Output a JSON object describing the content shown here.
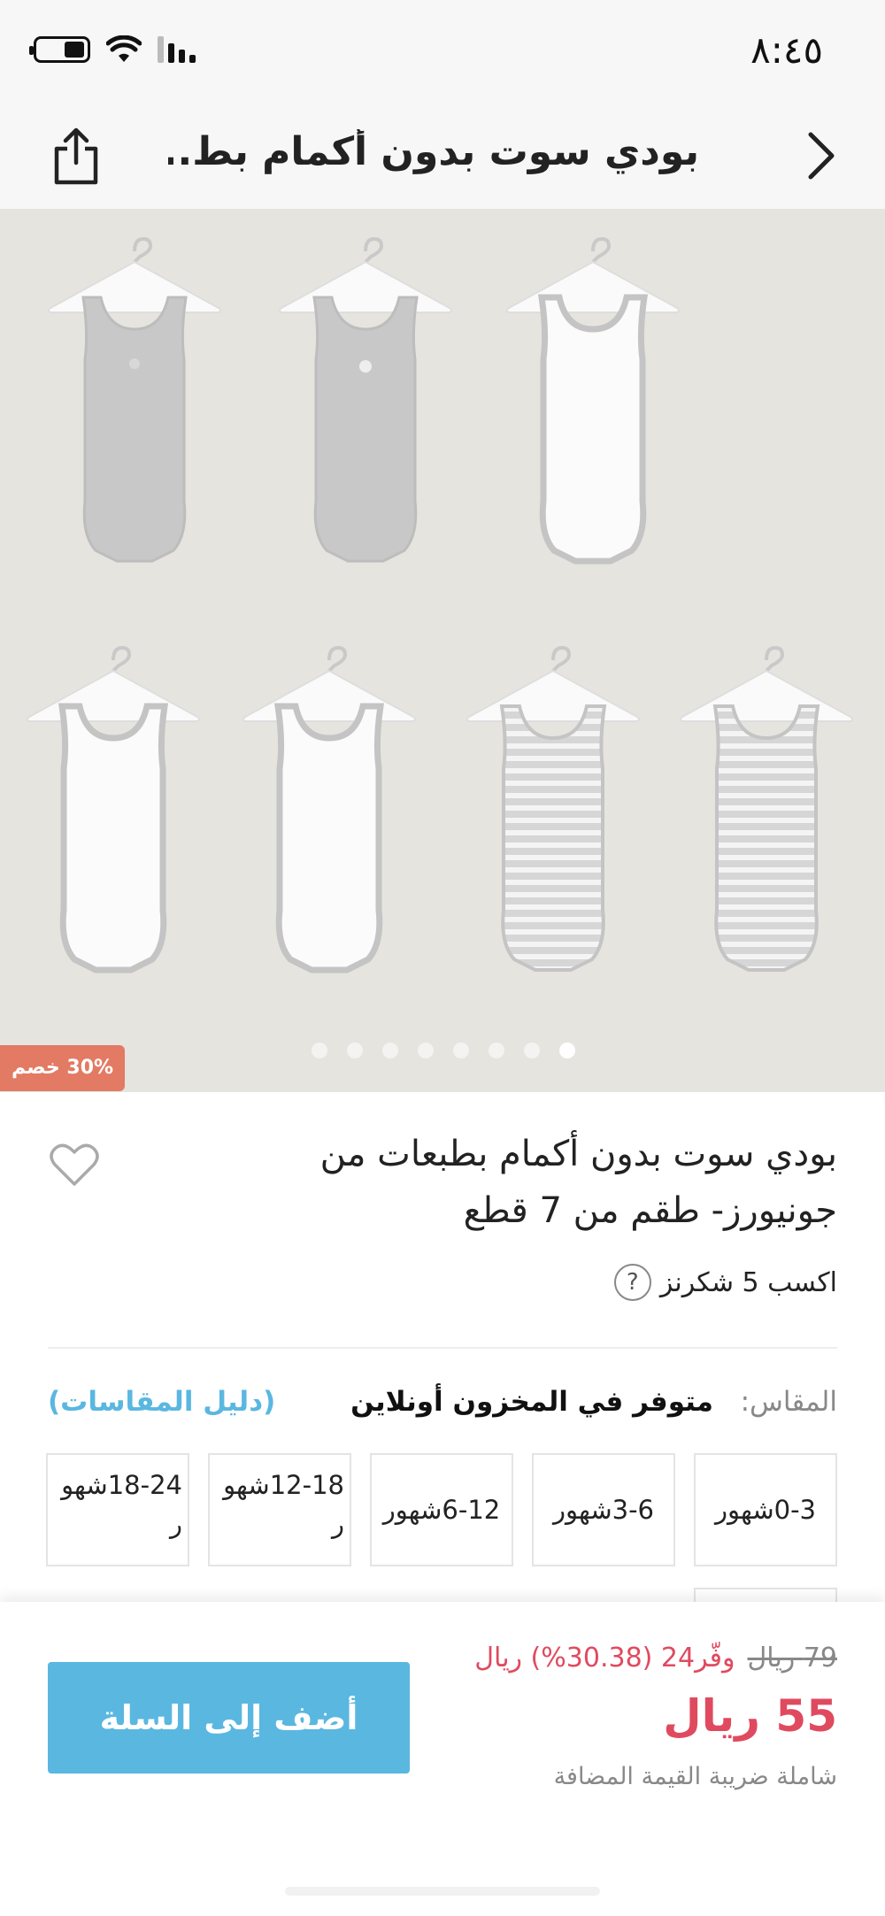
{
  "status_bar": {
    "time": "٨:٤٥"
  },
  "header": {
    "title": "بودي سوت بدون أكمام بط..."
  },
  "product": {
    "discount_badge": "30% خصم",
    "title": "بودي سوت بدون أكمام بطبعات من جونيورز- طقم من 7 قطع",
    "points_text": "اكسب 5 شكرنز",
    "help_symbol": "?",
    "image_count": 8,
    "active_image_index": 0
  },
  "size": {
    "label": "المقاس:",
    "stock_text": "متوفر في المخزون أونلاين",
    "guide_link": "(دليل المقاسات)",
    "options": [
      "0-3شهور",
      "3-6شهور",
      "6-12شهور",
      "12-18شهو ر",
      "18-24شهو ر",
      ""
    ]
  },
  "pricing": {
    "old_price": "79 ريال",
    "save_text": "وفّر24 (30.38%) ريال",
    "current_price": "55 ريال",
    "vat_note": "شاملة ضريبة القيمة المضافة"
  },
  "cart": {
    "add_button": "أضف إلى السلة"
  },
  "colors": {
    "accent": "#5ab7e0",
    "price_red": "#e04a5f",
    "badge": "#e37a63",
    "image_bg": "#e6e4df"
  },
  "icons": [
    "battery-icon",
    "wifi-icon",
    "signal-icon",
    "back-arrow-icon",
    "share-icon",
    "heart-icon",
    "help-icon"
  ]
}
